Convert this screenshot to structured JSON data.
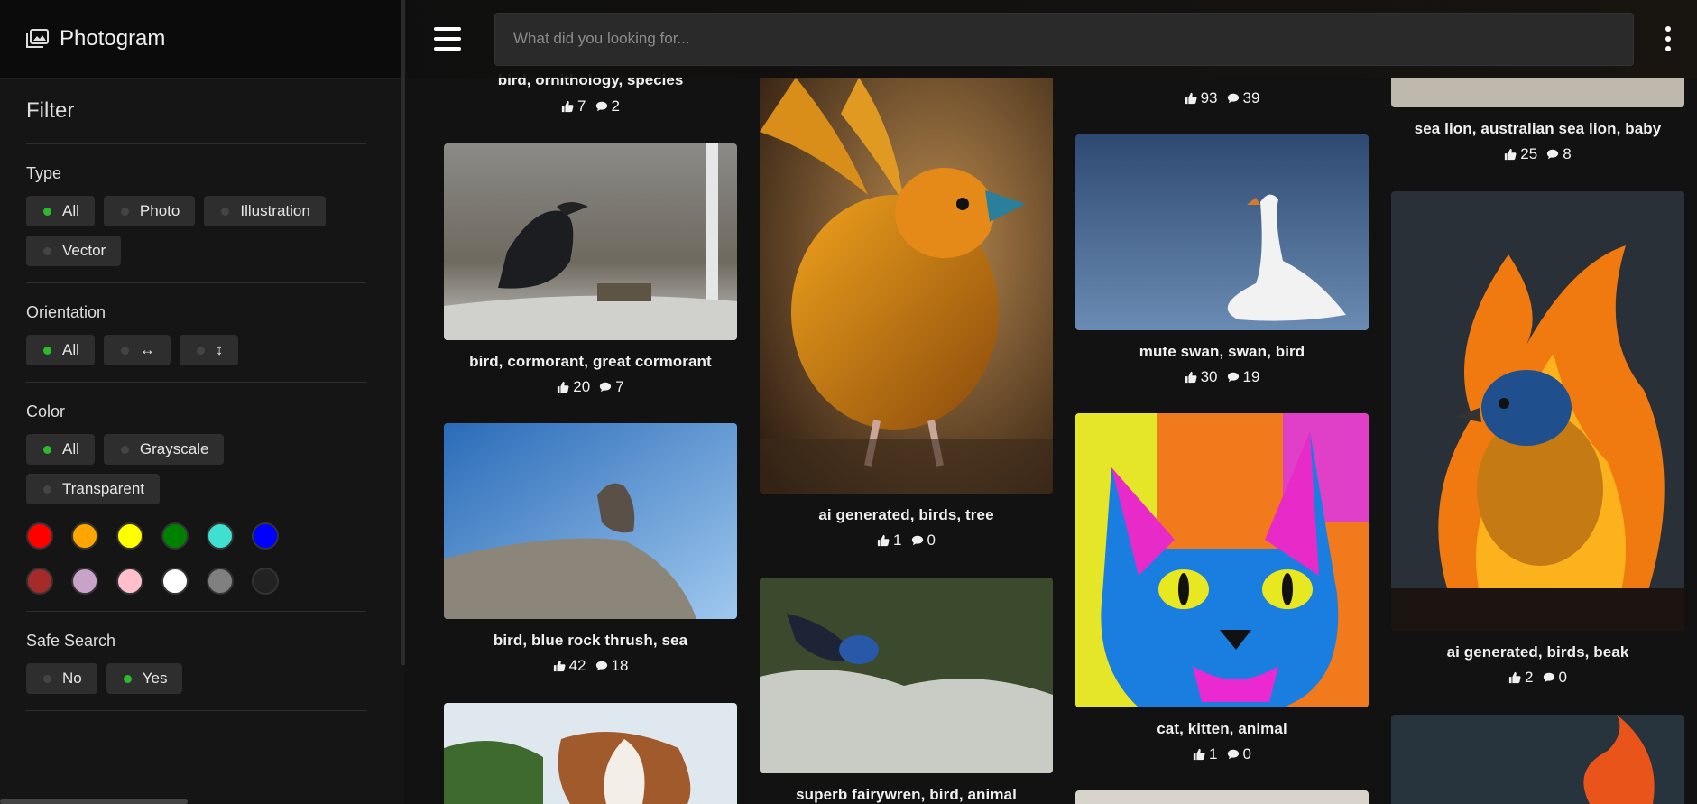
{
  "app": {
    "brand": "Photogram"
  },
  "search": {
    "placeholder": "What did you looking for...",
    "value": ""
  },
  "filter": {
    "title": "Filter",
    "type": {
      "title": "Type",
      "options": [
        "All",
        "Photo",
        "Illustration",
        "Vector"
      ],
      "selected": "All"
    },
    "orientation": {
      "title": "Orientation",
      "options": [
        "All",
        "↔",
        "↕"
      ],
      "selected": "All"
    },
    "color": {
      "title": "Color",
      "options": [
        "All",
        "Grayscale",
        "Transparent"
      ],
      "selected": "All",
      "swatches": [
        "#ff0000",
        "#ffa500",
        "#ffff00",
        "#008000",
        "#40e0d0",
        "#0000ff",
        "#a52a2a",
        "#c8a2c8",
        "#ffc0cb",
        "#ffffff",
        "#808080",
        "#222222"
      ]
    },
    "safe_search": {
      "title": "Safe Search",
      "options": [
        "No",
        "Yes"
      ],
      "selected": "Yes"
    }
  },
  "gallery": {
    "col1": [
      {
        "caption": "bird, ornithology, species",
        "likes": "7",
        "comments": "2"
      },
      {
        "caption": "bird, cormorant, great cormorant",
        "likes": "20",
        "comments": "7"
      },
      {
        "caption": "bird, blue rock thrush, sea",
        "likes": "42",
        "comments": "18"
      }
    ],
    "col2": [
      {
        "caption": "ai generated, birds, tree",
        "likes": "1",
        "comments": "0"
      },
      {
        "caption": "superb fairywren, bird, animal"
      }
    ],
    "col3": [
      {
        "likes": "93",
        "comments": "39"
      },
      {
        "caption": "mute swan, swan, bird",
        "likes": "30",
        "comments": "19"
      },
      {
        "caption": "cat, kitten, animal",
        "likes": "1",
        "comments": "0"
      }
    ],
    "col4": [
      {
        "caption": "sea lion, australian sea lion, baby",
        "likes": "25",
        "comments": "8"
      },
      {
        "caption": "ai generated, birds, beak",
        "likes": "2",
        "comments": "0"
      }
    ]
  },
  "colors": {
    "accent_dot": "#2db92d",
    "chip_bg": "#2e2e2e",
    "page_bg": "#121212"
  }
}
